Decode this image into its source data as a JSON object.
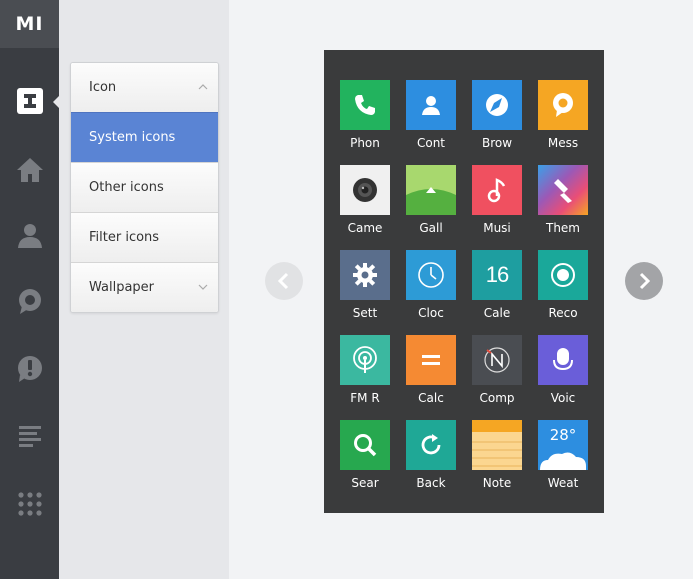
{
  "app": {
    "logo": "MI"
  },
  "left_nav": [
    {
      "name": "icon-tool-icon",
      "active": true
    },
    {
      "name": "home-icon"
    },
    {
      "name": "user-icon"
    },
    {
      "name": "chat-bubble-icon"
    },
    {
      "name": "alert-icon"
    },
    {
      "name": "list-icon"
    },
    {
      "name": "grid-dots-icon"
    }
  ],
  "menu": {
    "items": [
      {
        "label": "Icon",
        "state": "expanded"
      },
      {
        "label": "System icons",
        "state": "selected"
      },
      {
        "label": "Other icons"
      },
      {
        "label": "Filter icons"
      },
      {
        "label": "Wallpaper",
        "state": "collapsed"
      }
    ]
  },
  "preview": {
    "apps": [
      {
        "label": "Phon",
        "icon": "phone-icon",
        "color": "#22b35e"
      },
      {
        "label": "Cont",
        "icon": "contacts-icon",
        "color": "#2d8ee0"
      },
      {
        "label": "Brow",
        "icon": "browser-icon",
        "color": "#2d8ee0"
      },
      {
        "label": "Mess",
        "icon": "messaging-icon",
        "color": "#f5a623"
      },
      {
        "label": "Came",
        "icon": "camera-icon",
        "color": "#f0f0f0"
      },
      {
        "label": "Gall",
        "icon": "gallery-icon",
        "color": "#7cc24a"
      },
      {
        "label": "Musi",
        "icon": "music-icon",
        "color": "#f05060"
      },
      {
        "label": "Them",
        "icon": "themes-icon",
        "color": "#e94e77"
      },
      {
        "label": "Sett",
        "icon": "settings-icon",
        "color": "#5a6e8c"
      },
      {
        "label": "Cloc",
        "icon": "clock-icon",
        "color": "#2d9bd6"
      },
      {
        "label": "Cale",
        "icon": "calendar-icon",
        "color": "#1e9ea0",
        "day": "16"
      },
      {
        "label": "Reco",
        "icon": "recorder-icon",
        "color": "#1aa89a"
      },
      {
        "label": "FM R",
        "icon": "fm-radio-icon",
        "color": "#3bb8a0"
      },
      {
        "label": "Calc",
        "icon": "calculator-icon",
        "color": "#f58a33"
      },
      {
        "label": "Comp",
        "icon": "compass-icon",
        "color": "#4a4d52"
      },
      {
        "label": "Voic",
        "icon": "voice-icon",
        "color": "#6a5ed9"
      },
      {
        "label": "Sear",
        "icon": "search-icon",
        "color": "#27a84f"
      },
      {
        "label": "Back",
        "icon": "backup-icon",
        "color": "#1fa896"
      },
      {
        "label": "Note",
        "icon": "notes-icon",
        "color": "#f7c46a"
      },
      {
        "label": "Weat",
        "icon": "weather-icon",
        "color": "#2d8ee0",
        "temp": "28°"
      }
    ]
  }
}
